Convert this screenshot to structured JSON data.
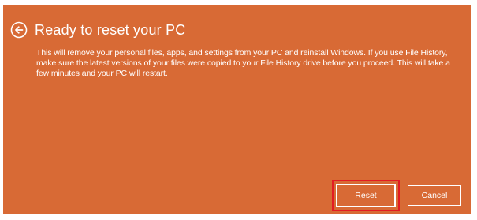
{
  "window": {
    "title": "Ready to reset your PC",
    "back_icon": "arrow-left-circle-icon"
  },
  "message": {
    "text": "This will remove your personal files, apps, and settings from your PC and reinstall Windows. If you use File History, make sure the latest versions of your files were copied to your File History drive before you proceed. This will take a few minutes and your PC will restart."
  },
  "buttons": {
    "reset_label": "Reset",
    "cancel_label": "Cancel"
  },
  "colors": {
    "background": "#d86a35",
    "highlight": "#e31b23",
    "text": "#ffffff"
  }
}
